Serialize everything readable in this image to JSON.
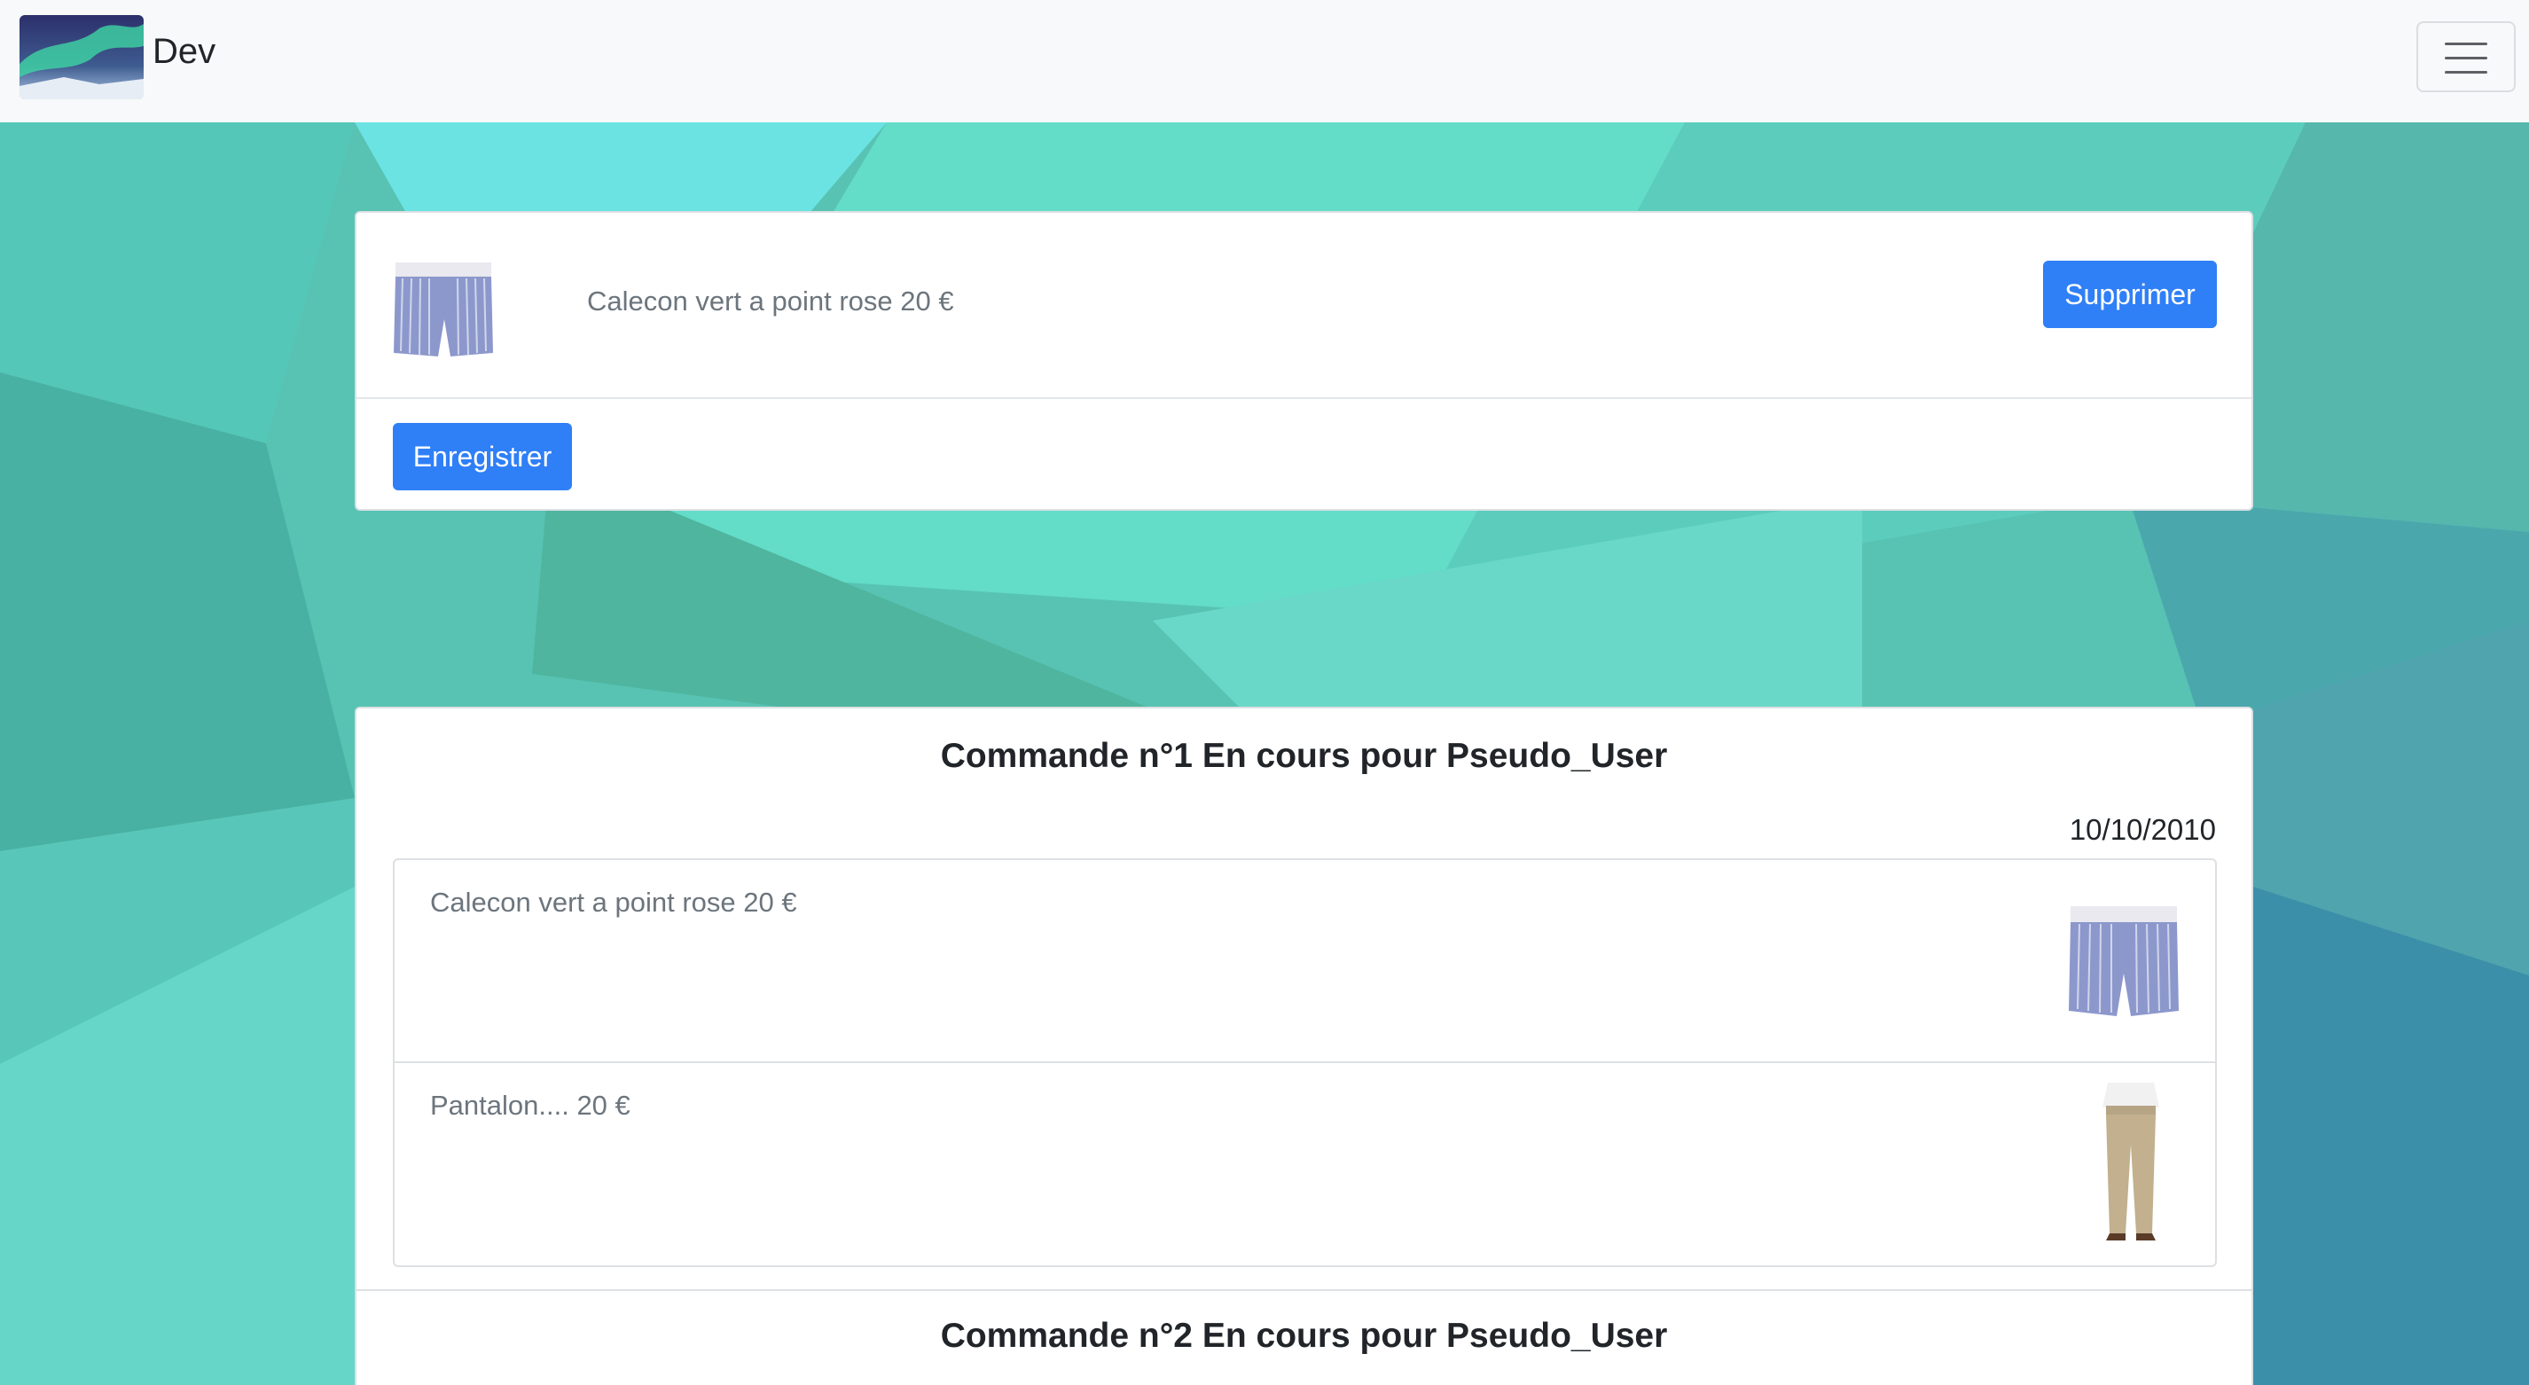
{
  "brand": {
    "name": "Dev",
    "logo": "aurora-landscape-image"
  },
  "navbar": {
    "toggle_icon": "hamburger-icon"
  },
  "cart": {
    "items": [
      {
        "label": "Calecon vert a point rose 20 €",
        "image": "boxer-shorts-image"
      }
    ],
    "delete_label": "Supprimer",
    "save_label": "Enregistrer"
  },
  "orders": [
    {
      "title": "Commande n°1 En cours pour Pseudo_User",
      "date": "10/10/2010",
      "items": [
        {
          "label": "Calecon vert a point rose 20 €",
          "image": "boxer-shorts-image"
        },
        {
          "label": "Pantalon.... 20 €",
          "image": "trousers-image"
        }
      ]
    },
    {
      "title": "Commande n°2 En cours pour Pseudo_User"
    }
  ],
  "colors": {
    "primary": "#2f7ff7",
    "navbar_bg": "#f8f9fa",
    "background": "#4fbfb0"
  }
}
